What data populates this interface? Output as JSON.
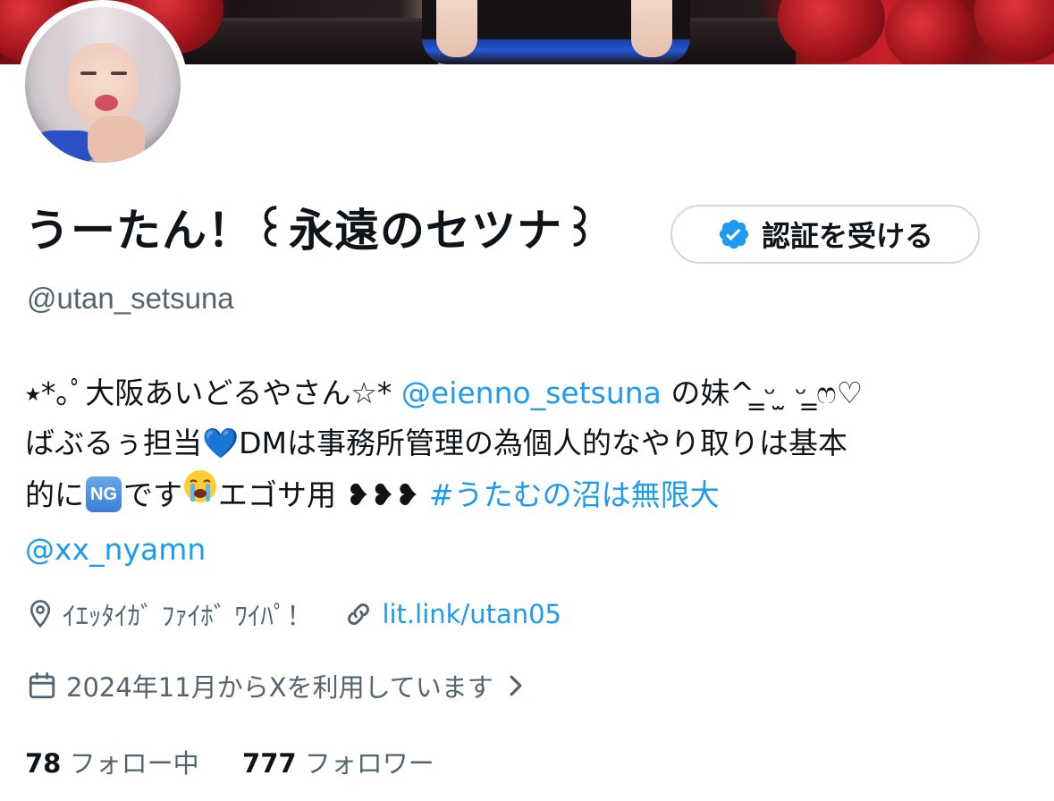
{
  "profile": {
    "display_name": "うーたん！꒰永遠のセツナ꒱",
    "handle": "@utan_setsuna",
    "verify_button_label": "認証を受ける"
  },
  "bio": {
    "line1_prefix": "⭑*｡ﾟ大阪あいどるやさん☆* ",
    "line1_mention": "@eienno_setsuna",
    "line1_suffix": " の妹^ ̳ᵕ ̫ ᵕ ̳ෆ♡",
    "line2_text": "ばぶるぅ担当",
    "line2_emoji": "💙",
    "line2_suffix": "DMは事務所管理の為個人的なやり取りは基本",
    "line3_prefix": "的に",
    "line3_ng": "NG",
    "line3_mid": "です",
    "line3_emoji": "😭",
    "line3_suffix": "エゴサ用 ❥❥❥ ",
    "line3_hashtag": "#うたむの沼は無限大",
    "line4_mention": "@xx_nyamn"
  },
  "meta": {
    "location_icon": "location-pin-icon",
    "location": "ｲｴｯﾀｲｶﾞ ﾌｧｲﾎﾞ ﾜｲﾊﾟ！",
    "link_icon": "link-icon",
    "link": "lit.link/utan05",
    "calendar_icon": "calendar-icon",
    "joined": "2024年11月からXを利用しています",
    "joined_chevron": "chevron-right-icon"
  },
  "stats": {
    "following_count": "78",
    "following_label": "フォロー中",
    "followers_count": "777",
    "followers_label": "フォロワー"
  },
  "colors": {
    "accent": "#1d9bf0",
    "secondary_text": "#536471",
    "primary_text": "#0f1419",
    "border": "#cfd9de"
  }
}
